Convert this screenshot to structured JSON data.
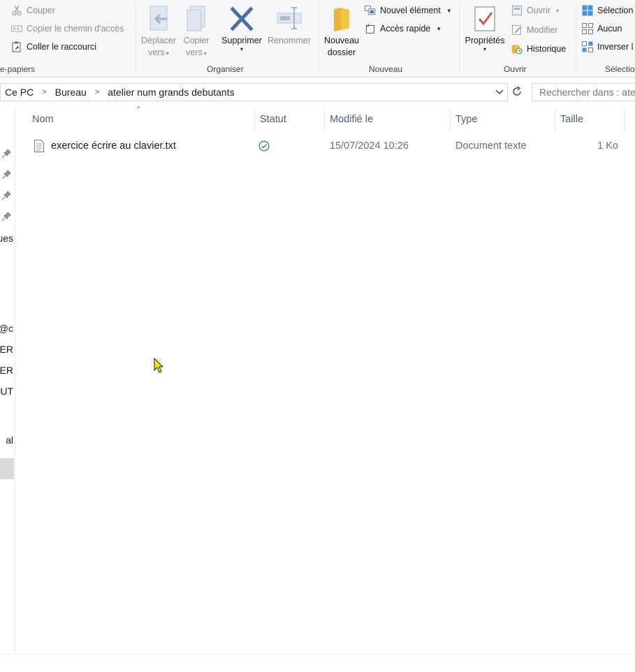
{
  "ribbon": {
    "clipboard": {
      "group_label": "e-papiers",
      "cut": "Couper",
      "copy_path": "Copier le chemin d'accès",
      "paste_shortcut": "Coller le raccourci"
    },
    "organize": {
      "group_label": "Organiser",
      "move_to": [
        "Déplacer",
        "vers"
      ],
      "copy_to": [
        "Copier",
        "vers"
      ],
      "delete": "Supprimer",
      "rename": "Renommer"
    },
    "new": {
      "group_label": "Nouveau",
      "new_folder": [
        "Nouveau",
        "dossier"
      ],
      "new_item": "Nouvel élément",
      "easy_access": "Accès rapide"
    },
    "open": {
      "group_label": "Ouvrir",
      "properties": "Propriétés",
      "open": "Ouvrir",
      "edit": "Modifier",
      "history": "Historique"
    },
    "select": {
      "group_label": "Sélectio",
      "select_all": "Sélection",
      "select_none": "Aucun",
      "invert": "Inverser l"
    }
  },
  "address": {
    "crumbs": [
      "Ce PC",
      "Bureau",
      "atelier num grands debutants"
    ]
  },
  "search": {
    "placeholder": "Rechercher dans : atelier num grands debutants"
  },
  "nav": {
    "items": [
      "ues",
      "@c",
      "ER",
      "ER",
      "UT",
      "al"
    ]
  },
  "columns": {
    "name": "Nom",
    "status": "Statut",
    "modified": "Modifié le",
    "type": "Type",
    "size": "Taille"
  },
  "files": [
    {
      "name": "exercice écrire au clavier.txt",
      "modified": "15/07/2024 10:26",
      "type": "Document texte",
      "size": "1 Ko",
      "status_icon": "synced-check-icon"
    }
  ],
  "colors": {
    "ribbon_bg": "#f5f6f7",
    "header_text": "#4c607a",
    "muted_text": "#6d6d6d",
    "status_green": "#2e8b57",
    "folder_yellow": "#f4c542",
    "delete_blue": "#4a6fa5"
  }
}
